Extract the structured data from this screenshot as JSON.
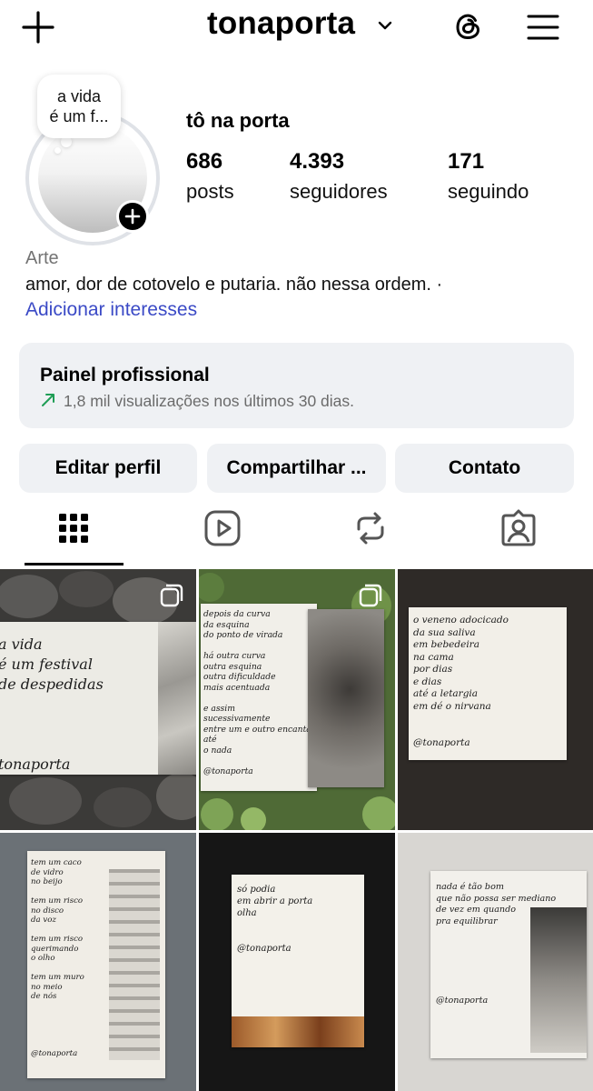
{
  "header": {
    "username": "tonaporta",
    "icons": {
      "new_post": "plus-icon",
      "account_switch": "chevron-down-icon",
      "threads": "threads-icon",
      "menu": "hamburger-menu-icon"
    }
  },
  "profile": {
    "note": "a vida\né um f...",
    "display_name": "tô na porta",
    "stats": [
      {
        "value": "686",
        "label": "posts"
      },
      {
        "value": "4.393",
        "label": "seguidores"
      },
      {
        "value": "171",
        "label": "seguindo"
      }
    ],
    "category": "Arte",
    "bio": "amor, dor de cotovelo e putaria. não nessa ordem. ·",
    "add_interests": "Adicionar interesses"
  },
  "pro_panel": {
    "title": "Painel profissional",
    "subtitle": "1,8 mil visualizações nos últimos 30 dias.",
    "trend_color": "#1f9d55"
  },
  "actions": {
    "edit": "Editar perfil",
    "share": "Compartilhar ...",
    "contact": "Contato"
  },
  "tabs": [
    "grid-icon",
    "reels-icon",
    "reposts-icon",
    "tagged-icon"
  ],
  "posts": [
    {
      "text": "a vida\né um festival\nde despedidas\n\n\n\ntonaporta",
      "multi": true
    },
    {
      "text": "depois da curva\nda esquina\ndo ponto de virada\n\nhá outra curva\noutra esquina\noutra dificuldade\nmais acentuada\n\ne assim\nsucessivamente\nentre um e outro encantamento\naté\no nada\n\n@tonaporta",
      "multi": true
    },
    {
      "text": "o veneno adocicado\nda sua saliva\nem bebedeira\nna cama\npor dias\ne dias\naté a letargia\nem dé o nirvana\n\n\n@tonaporta",
      "multi": false
    },
    {
      "text": "tem um caco\nde vidro\nno beijo\n\ntem um risco\nno disco\nda voz\n\ntem um risco\nquerimando\no olho\n\ntem um muro\nno meio\nde nós\n\n\n\n\n\n@tonaporta",
      "multi": false
    },
    {
      "text": "só podia\nem abrir a porta\nolha\n\n\n@tonaporta",
      "multi": false
    },
    {
      "text": "nada é tão bom\nque não possa ser mediano\nde vez em quando\npra equilibrar\n\n\n\n\n\n\n@tonaporta",
      "multi": false
    }
  ],
  "colors": {
    "link": "#3b4ac6",
    "panel_bg": "#eff1f4",
    "muted": "#737373"
  }
}
